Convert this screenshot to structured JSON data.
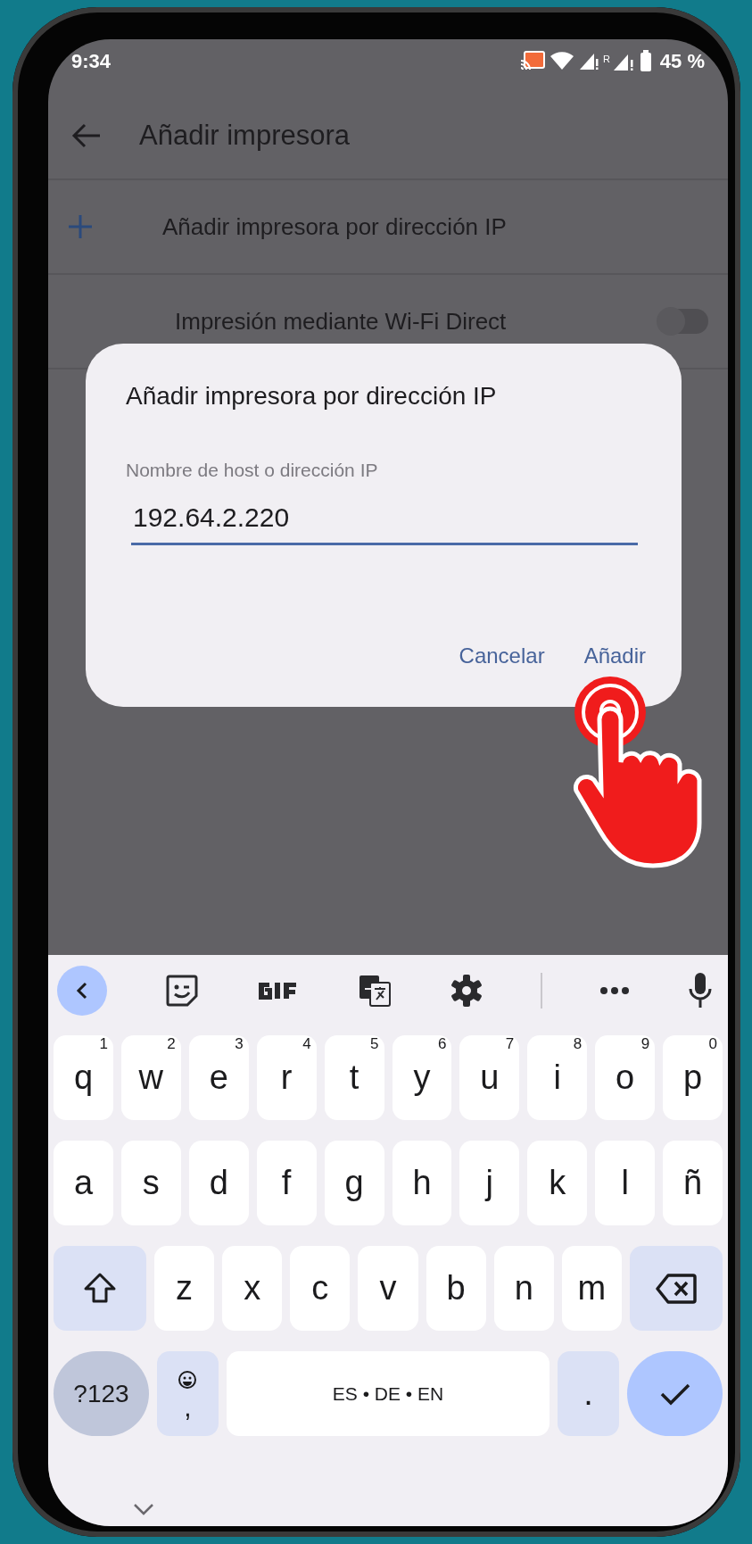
{
  "status_bar": {
    "time": "9:34",
    "roaming_mark": "R",
    "battery": "45 %"
  },
  "app_bar": {
    "title": "Añadir impresora"
  },
  "items": [
    {
      "kind": "action",
      "label": "Añadir impresora por dirección IP"
    },
    {
      "kind": "toggle",
      "label": "Impresión mediante Wi-Fi Direct",
      "on": false
    }
  ],
  "dialog": {
    "title": "Añadir impresora por dirección IP",
    "field": {
      "label": "Nombre de host o dirección IP",
      "value": "192.64.2.220"
    },
    "buttons": [
      "Cancelar",
      "Añadir"
    ]
  },
  "keyboard": {
    "rows": [
      {
        "keys": [
          {
            "kind": "letter",
            "label": "q",
            "hint": "1"
          },
          {
            "kind": "letter",
            "label": "w",
            "hint": "2"
          },
          {
            "kind": "letter",
            "label": "e",
            "hint": "3"
          },
          {
            "kind": "letter",
            "label": "r",
            "hint": "4"
          },
          {
            "kind": "letter",
            "label": "t",
            "hint": "5"
          },
          {
            "kind": "letter",
            "label": "y",
            "hint": "6"
          },
          {
            "kind": "letter",
            "label": "u",
            "hint": "7"
          },
          {
            "kind": "letter",
            "label": "i",
            "hint": "8"
          },
          {
            "kind": "letter",
            "label": "o",
            "hint": "9"
          },
          {
            "kind": "letter",
            "label": "p",
            "hint": "0"
          }
        ]
      },
      {
        "keys": [
          {
            "kind": "letter",
            "label": "a"
          },
          {
            "kind": "letter",
            "label": "s"
          },
          {
            "kind": "letter",
            "label": "d"
          },
          {
            "kind": "letter",
            "label": "f"
          },
          {
            "kind": "letter",
            "label": "g"
          },
          {
            "kind": "letter",
            "label": "h"
          },
          {
            "kind": "letter",
            "label": "j"
          },
          {
            "kind": "letter",
            "label": "k"
          },
          {
            "kind": "letter",
            "label": "l"
          },
          {
            "kind": "letter",
            "label": "ñ"
          }
        ]
      },
      {
        "keys": [
          {
            "kind": "shift"
          },
          {
            "kind": "letter",
            "label": "z"
          },
          {
            "kind": "letter",
            "label": "x"
          },
          {
            "kind": "letter",
            "label": "c"
          },
          {
            "kind": "letter",
            "label": "v"
          },
          {
            "kind": "letter",
            "label": "b"
          },
          {
            "kind": "letter",
            "label": "n"
          },
          {
            "kind": "letter",
            "label": "m"
          },
          {
            "kind": "backspace"
          }
        ]
      },
      {
        "keys": [
          {
            "kind": "symbols",
            "label": "?123"
          },
          {
            "kind": "emoji",
            "label": ","
          },
          {
            "kind": "space",
            "label": "ES • DE • EN"
          },
          {
            "kind": "special",
            "label": "."
          },
          {
            "kind": "enter"
          }
        ]
      }
    ]
  }
}
